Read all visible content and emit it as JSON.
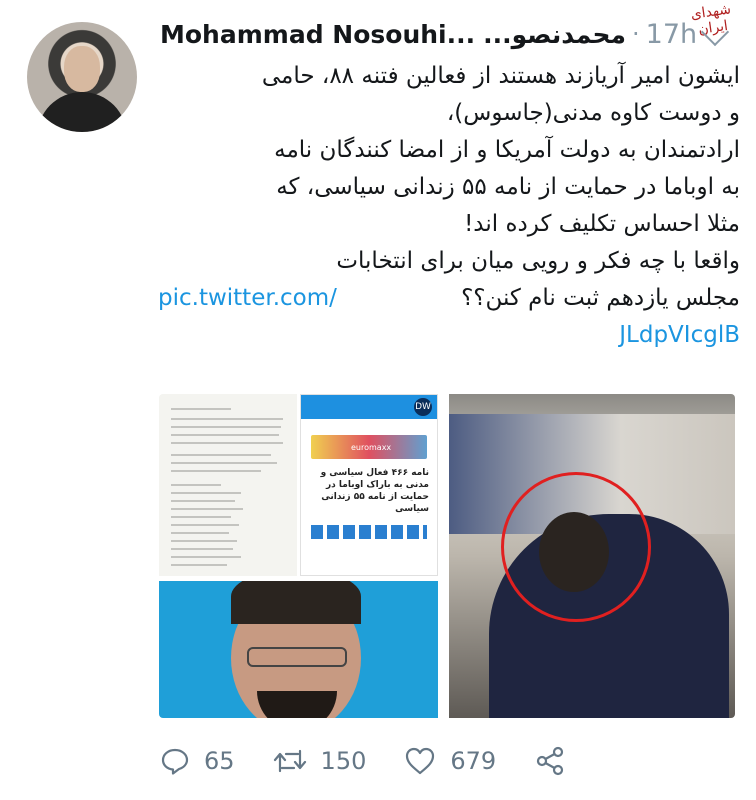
{
  "watermark": "شهدای ایران",
  "tweet": {
    "display_name": "Mohammad Nosouhi...",
    "display_name_fa": "محمدنصو...",
    "separator": "·",
    "time": "17h",
    "text_lines": [
      "ایشون امیر آریازند هستند از فعالین فتنه ۸۸، حامی",
      "و دوست کاوه مدنی(جاسوس)،",
      "ارادتمندان به دولت آمریکا و از امضا کنندگان نامه",
      "به اوباما در حمایت از نامه ۵۵ زندانی سیاسی، که",
      "مثلا احساس تکلیف کرده اند!",
      "واقعا با چه فکر و رویی میان برای انتخابات"
    ],
    "last_line_text": "مجلس یازدهم ثبت نام کنن؟؟",
    "link_part1": "pic.twitter.com/",
    "link_part2": "JLdpVIcglB"
  },
  "media": {
    "dw_headline": "نامه ۴۶۶ فعال سیاسی و مدنی به باراک اوباما در حمایت از نامه ۵۵ زندانی سیاسی",
    "dw_logo": "DW",
    "ad_text": "euromaxx"
  },
  "actions": {
    "replies": "65",
    "retweets": "150",
    "likes": "679"
  },
  "colors": {
    "link": "#1b95e0",
    "muted": "#657786"
  }
}
